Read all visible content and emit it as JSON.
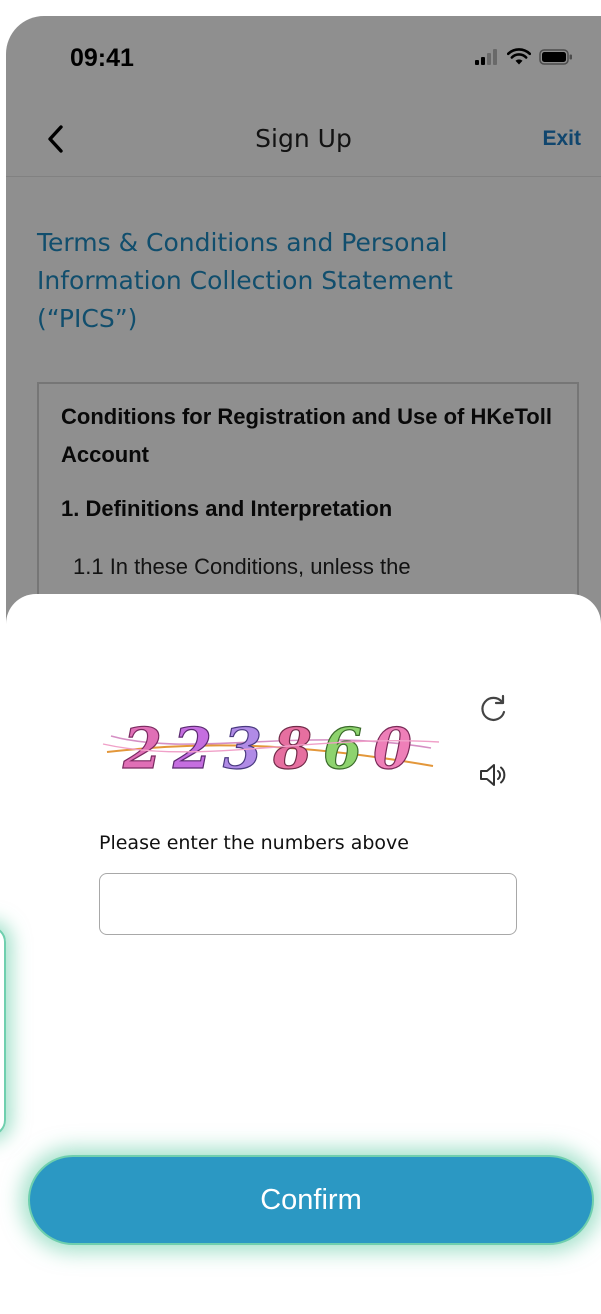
{
  "status_bar": {
    "time": "09:41",
    "icons": [
      "cellular-signal-icon",
      "wifi-icon",
      "battery-icon"
    ]
  },
  "nav": {
    "back_icon": "chevron-left-icon",
    "title": "Sign Up",
    "exit_label": "Exit"
  },
  "terms": {
    "heading": "Terms & Conditions and Personal Information Collection Statement (“PICS”)",
    "box_title": "Conditions for Registration and Use of HKeToll Account",
    "section_title": "1. Definitions and Interpretation",
    "clause_partial": "1.1   In these Conditions, unless the"
  },
  "captcha": {
    "code": "223860",
    "refresh_icon": "refresh-icon",
    "audio_icon": "speaker-icon",
    "prompt": "Please enter the numbers above",
    "input_value": "",
    "input_placeholder": ""
  },
  "actions": {
    "confirm_label": "Confirm"
  },
  "colors": {
    "accent_blue": "#1f8cc2",
    "confirm_blue": "#2b98c3",
    "exit_blue": "#1e7dc4",
    "highlight_green": "#6fcfae"
  }
}
